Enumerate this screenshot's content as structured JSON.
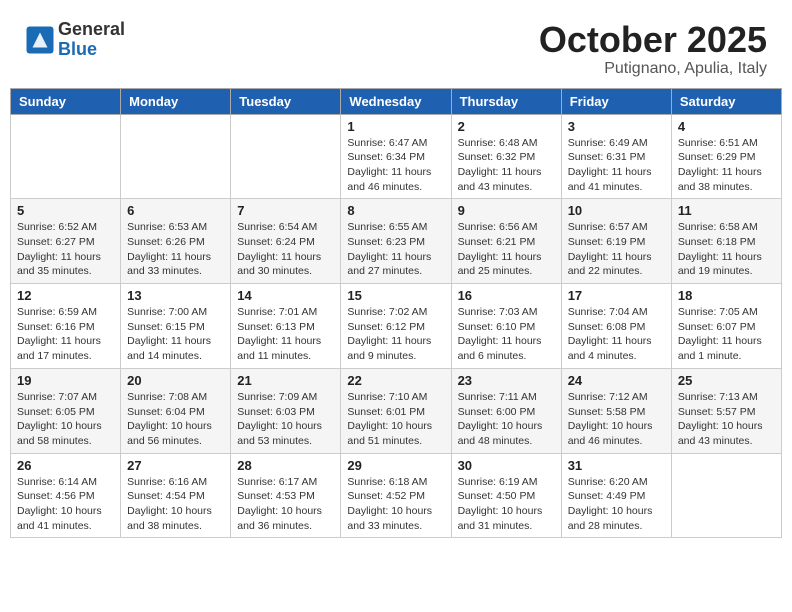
{
  "header": {
    "logo_general": "General",
    "logo_blue": "Blue",
    "month_title": "October 2025",
    "location": "Putignano, Apulia, Italy"
  },
  "days_of_week": [
    "Sunday",
    "Monday",
    "Tuesday",
    "Wednesday",
    "Thursday",
    "Friday",
    "Saturday"
  ],
  "weeks": [
    [
      {
        "day": "",
        "info": ""
      },
      {
        "day": "",
        "info": ""
      },
      {
        "day": "",
        "info": ""
      },
      {
        "day": "1",
        "info": "Sunrise: 6:47 AM\nSunset: 6:34 PM\nDaylight: 11 hours\nand 46 minutes."
      },
      {
        "day": "2",
        "info": "Sunrise: 6:48 AM\nSunset: 6:32 PM\nDaylight: 11 hours\nand 43 minutes."
      },
      {
        "day": "3",
        "info": "Sunrise: 6:49 AM\nSunset: 6:31 PM\nDaylight: 11 hours\nand 41 minutes."
      },
      {
        "day": "4",
        "info": "Sunrise: 6:51 AM\nSunset: 6:29 PM\nDaylight: 11 hours\nand 38 minutes."
      }
    ],
    [
      {
        "day": "5",
        "info": "Sunrise: 6:52 AM\nSunset: 6:27 PM\nDaylight: 11 hours\nand 35 minutes."
      },
      {
        "day": "6",
        "info": "Sunrise: 6:53 AM\nSunset: 6:26 PM\nDaylight: 11 hours\nand 33 minutes."
      },
      {
        "day": "7",
        "info": "Sunrise: 6:54 AM\nSunset: 6:24 PM\nDaylight: 11 hours\nand 30 minutes."
      },
      {
        "day": "8",
        "info": "Sunrise: 6:55 AM\nSunset: 6:23 PM\nDaylight: 11 hours\nand 27 minutes."
      },
      {
        "day": "9",
        "info": "Sunrise: 6:56 AM\nSunset: 6:21 PM\nDaylight: 11 hours\nand 25 minutes."
      },
      {
        "day": "10",
        "info": "Sunrise: 6:57 AM\nSunset: 6:19 PM\nDaylight: 11 hours\nand 22 minutes."
      },
      {
        "day": "11",
        "info": "Sunrise: 6:58 AM\nSunset: 6:18 PM\nDaylight: 11 hours\nand 19 minutes."
      }
    ],
    [
      {
        "day": "12",
        "info": "Sunrise: 6:59 AM\nSunset: 6:16 PM\nDaylight: 11 hours\nand 17 minutes."
      },
      {
        "day": "13",
        "info": "Sunrise: 7:00 AM\nSunset: 6:15 PM\nDaylight: 11 hours\nand 14 minutes."
      },
      {
        "day": "14",
        "info": "Sunrise: 7:01 AM\nSunset: 6:13 PM\nDaylight: 11 hours\nand 11 minutes."
      },
      {
        "day": "15",
        "info": "Sunrise: 7:02 AM\nSunset: 6:12 PM\nDaylight: 11 hours\nand 9 minutes."
      },
      {
        "day": "16",
        "info": "Sunrise: 7:03 AM\nSunset: 6:10 PM\nDaylight: 11 hours\nand 6 minutes."
      },
      {
        "day": "17",
        "info": "Sunrise: 7:04 AM\nSunset: 6:08 PM\nDaylight: 11 hours\nand 4 minutes."
      },
      {
        "day": "18",
        "info": "Sunrise: 7:05 AM\nSunset: 6:07 PM\nDaylight: 11 hours\nand 1 minute."
      }
    ],
    [
      {
        "day": "19",
        "info": "Sunrise: 7:07 AM\nSunset: 6:05 PM\nDaylight: 10 hours\nand 58 minutes."
      },
      {
        "day": "20",
        "info": "Sunrise: 7:08 AM\nSunset: 6:04 PM\nDaylight: 10 hours\nand 56 minutes."
      },
      {
        "day": "21",
        "info": "Sunrise: 7:09 AM\nSunset: 6:03 PM\nDaylight: 10 hours\nand 53 minutes."
      },
      {
        "day": "22",
        "info": "Sunrise: 7:10 AM\nSunset: 6:01 PM\nDaylight: 10 hours\nand 51 minutes."
      },
      {
        "day": "23",
        "info": "Sunrise: 7:11 AM\nSunset: 6:00 PM\nDaylight: 10 hours\nand 48 minutes."
      },
      {
        "day": "24",
        "info": "Sunrise: 7:12 AM\nSunset: 5:58 PM\nDaylight: 10 hours\nand 46 minutes."
      },
      {
        "day": "25",
        "info": "Sunrise: 7:13 AM\nSunset: 5:57 PM\nDaylight: 10 hours\nand 43 minutes."
      }
    ],
    [
      {
        "day": "26",
        "info": "Sunrise: 6:14 AM\nSunset: 4:56 PM\nDaylight: 10 hours\nand 41 minutes."
      },
      {
        "day": "27",
        "info": "Sunrise: 6:16 AM\nSunset: 4:54 PM\nDaylight: 10 hours\nand 38 minutes."
      },
      {
        "day": "28",
        "info": "Sunrise: 6:17 AM\nSunset: 4:53 PM\nDaylight: 10 hours\nand 36 minutes."
      },
      {
        "day": "29",
        "info": "Sunrise: 6:18 AM\nSunset: 4:52 PM\nDaylight: 10 hours\nand 33 minutes."
      },
      {
        "day": "30",
        "info": "Sunrise: 6:19 AM\nSunset: 4:50 PM\nDaylight: 10 hours\nand 31 minutes."
      },
      {
        "day": "31",
        "info": "Sunrise: 6:20 AM\nSunset: 4:49 PM\nDaylight: 10 hours\nand 28 minutes."
      },
      {
        "day": "",
        "info": ""
      }
    ]
  ]
}
